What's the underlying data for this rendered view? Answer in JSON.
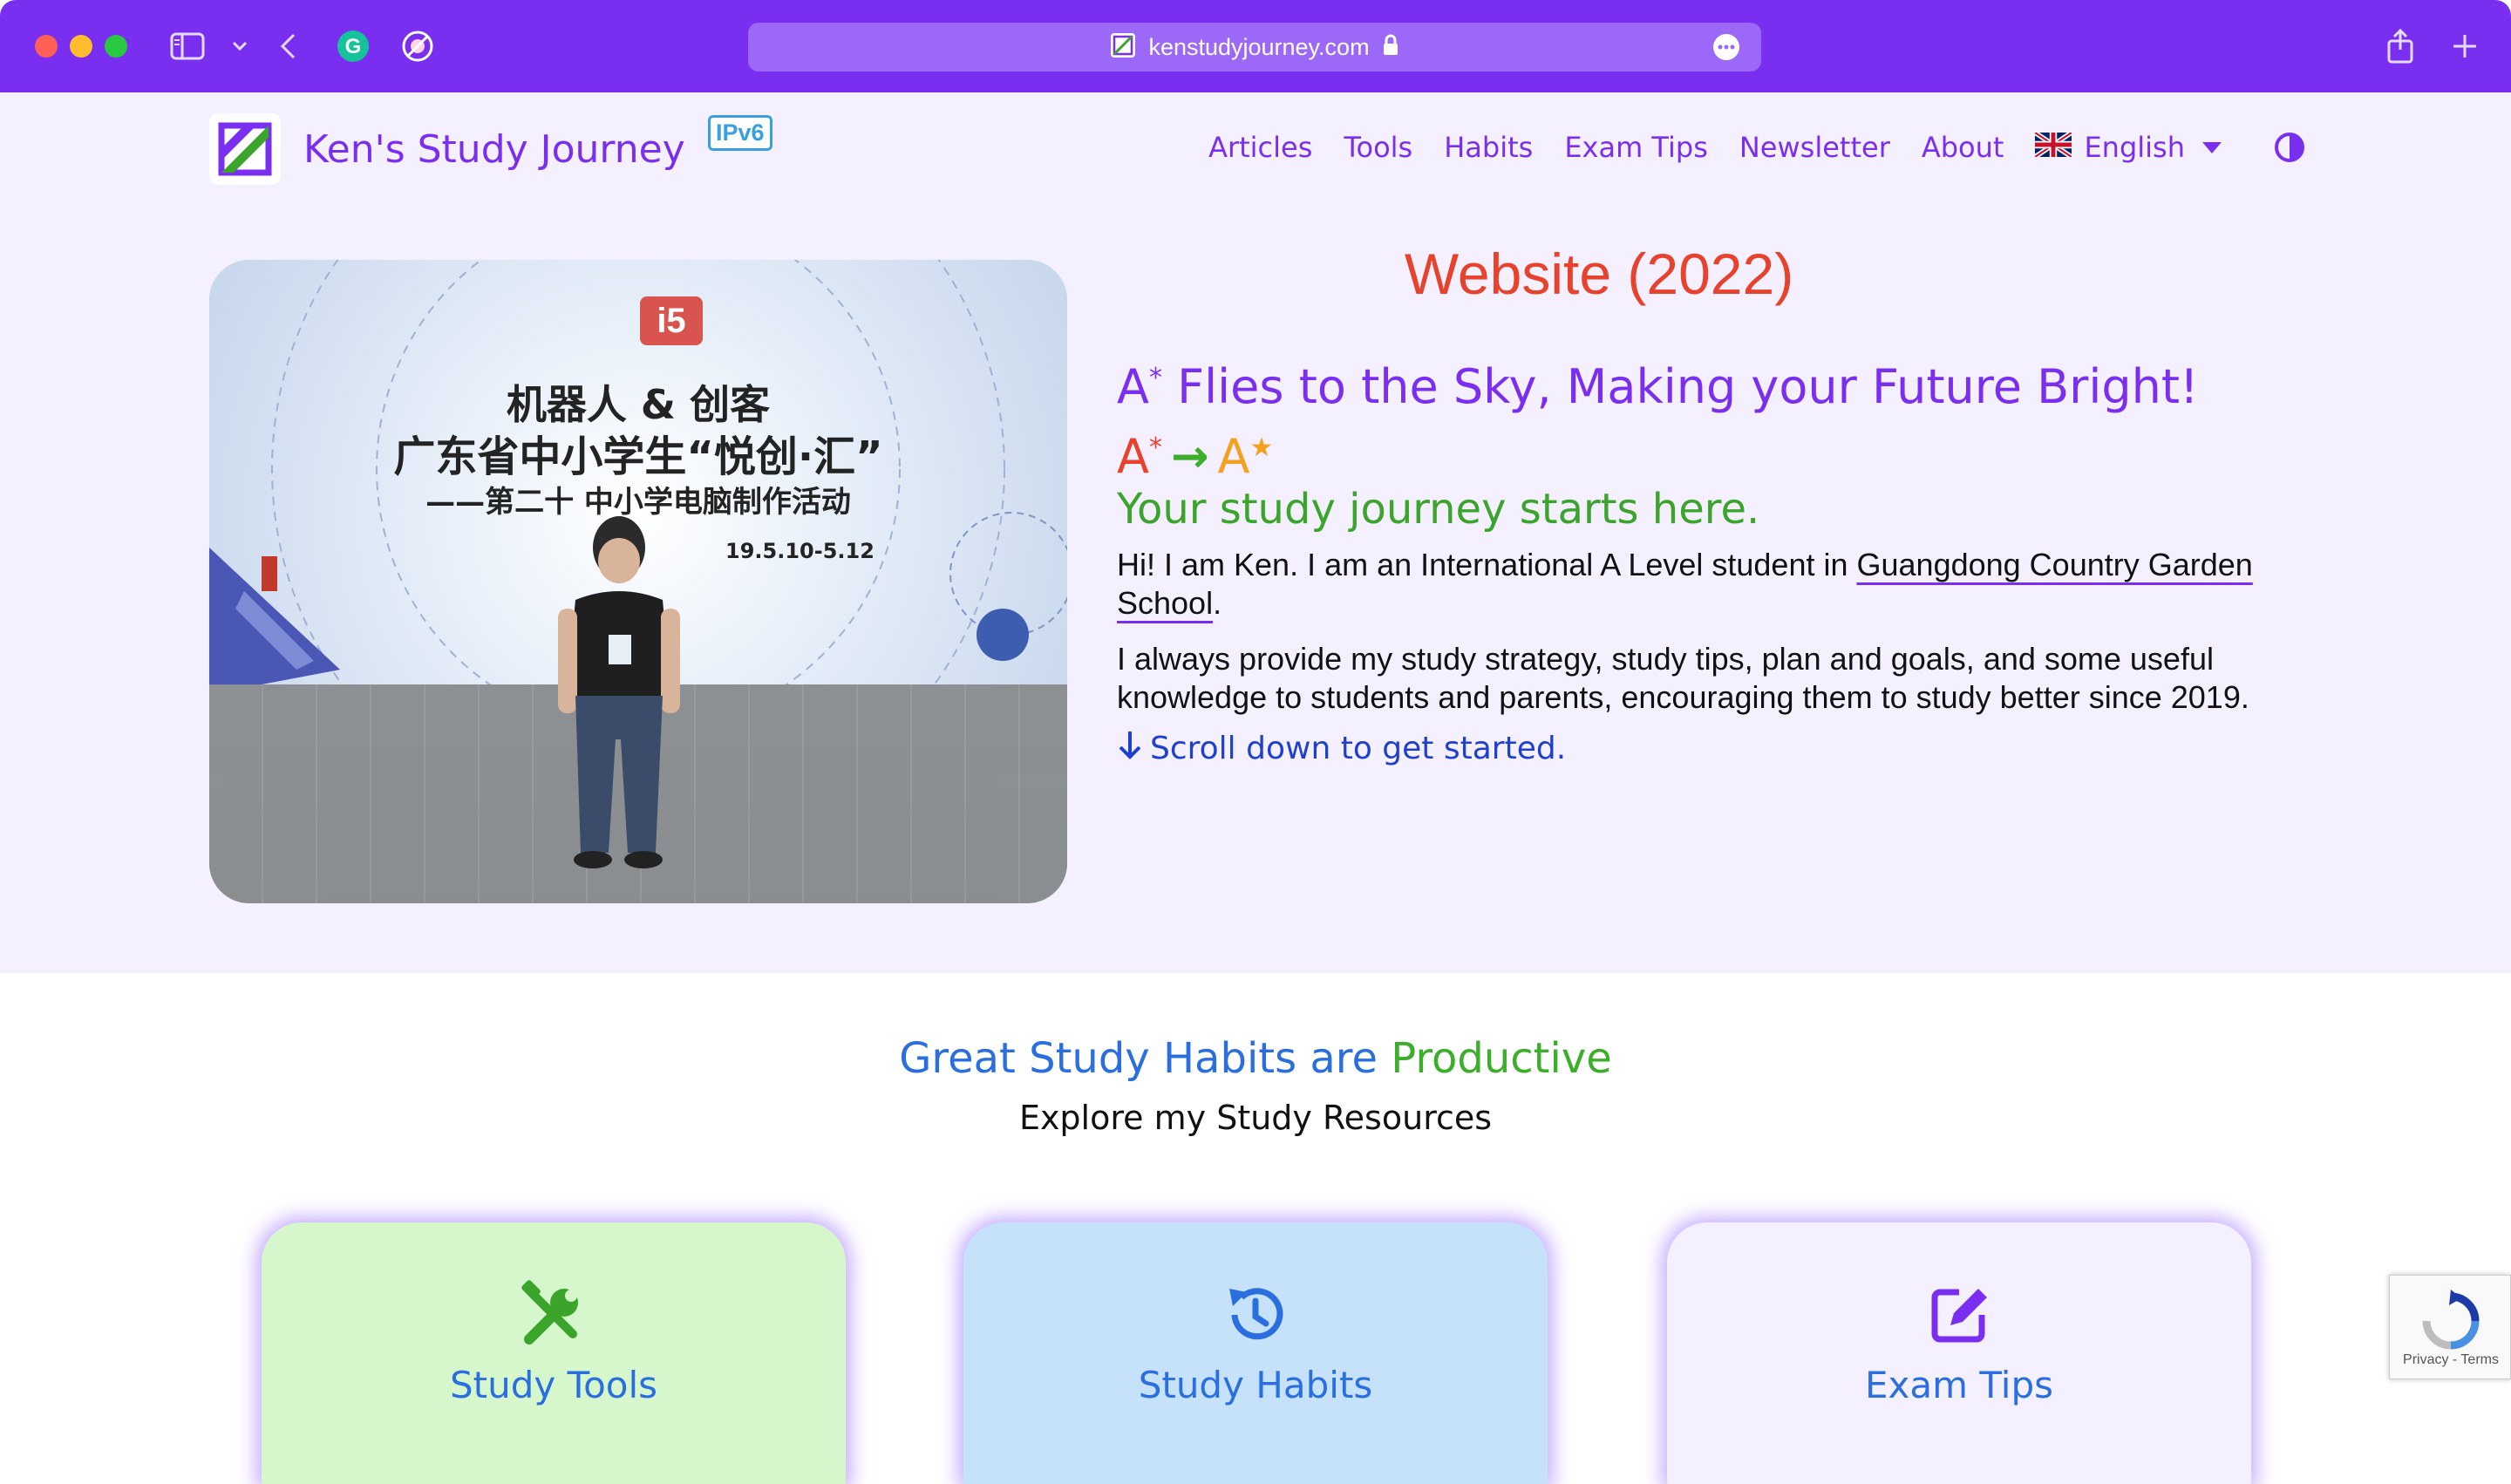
{
  "browser": {
    "domain": "kenstudyjourney.com"
  },
  "nav": {
    "brand": "Ken's Study Journey",
    "badge": "IPv6",
    "items": [
      "Articles",
      "Tools",
      "Habits",
      "Exam Tips",
      "Newsletter",
      "About"
    ],
    "language": "English"
  },
  "hero": {
    "title": "Website (2022)",
    "tagline_prefix": "A",
    "tagline_sup": "*",
    "tagline_text": " Flies to the Sky, Making your Future Bright!",
    "grade_from": "A",
    "grade_from_sup": "*",
    "grade_to": "A",
    "grade_to_sup": "★",
    "arrow": "→",
    "start": "Your study journey starts here.",
    "intro_prefix": "Hi! I am Ken. I am an International A Level student in ",
    "school": "Guangdong Country Garden School",
    "intro_suffix": ".",
    "para2": "I always provide my study strategy, study tips, plan and goals, and some useful knowledge to students and parents, encouraging them to study better since 2019.",
    "scroll": "Scroll down to get started."
  },
  "photo": {
    "line1": "机器人 & 创客",
    "line2": "广东省中小学生“悦创·汇”",
    "line3": "——第二十 中小学电脑制作活动",
    "date": "19.5.10-5.12"
  },
  "section2": {
    "title_part1": "Great Study Habits are ",
    "title_part2": "Productive",
    "subtitle": "Explore my Study Resources",
    "cards": [
      {
        "label": "Study Tools",
        "icon": "tools-icon"
      },
      {
        "label": "Study Habits",
        "icon": "history-icon"
      },
      {
        "label": "Exam Tips",
        "icon": "edit-icon"
      }
    ]
  },
  "recaptcha": {
    "links": "Privacy - Terms"
  },
  "colors": {
    "accent": "#7a2ff0",
    "title_red": "#e8412c",
    "green": "#3ba52b",
    "blue": "#2a6ee0"
  }
}
